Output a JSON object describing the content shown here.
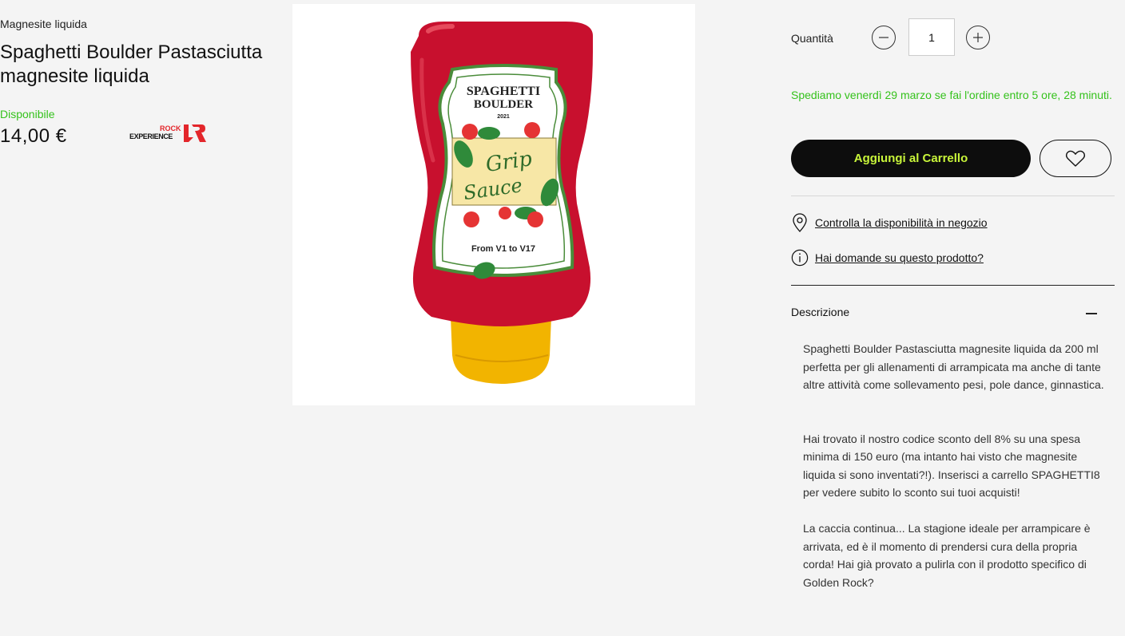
{
  "product": {
    "category": "Magnesite liquida",
    "title": "Spaghetti Boulder Pastasciutta magnesite liquida",
    "availability": "Disponibile",
    "price": "14,00 €",
    "brand": {
      "logo_text_top": "ROCK",
      "logo_text_bottom": "EXPERIENCE",
      "logo_icon": "rock-experience-logo"
    }
  },
  "image": {
    "label_line1": "SPAGHETTI",
    "label_line2": "BOULDER",
    "label_year": "2021",
    "label_script1": "Grip",
    "label_script2": "Sauce",
    "label_bottom": "From V1 to V17"
  },
  "purchase": {
    "quantity_label": "Quantità",
    "quantity_value": "1",
    "shipping_notice": "Spediamo venerdì 29 marzo se fai l'ordine entro 5 ore, 28 minuti.",
    "add_to_cart": "Aggiungi al Carrello"
  },
  "links": {
    "store_availability": "Controlla la disponibilità in negozio",
    "questions": "Hai domande su questo prodotto?"
  },
  "description": {
    "heading": "Descrizione",
    "paragraphs": [
      "Spaghetti Boulder Pastasciutta magnesite liquida da 200 ml perfetta per gli allenamenti di arrampicata ma anche di tante altre attività come sollevamento pesi, pole dance, ginnastica.",
      "Hai trovato il nostro codice sconto dell 8% su una spesa minima di 150 euro (ma intanto hai visto che magnesite liquida si sono inventati?!). Inserisci a carrello SPAGHETTI8 per vedere subito lo sconto sui tuoi acquisti!",
      "La caccia continua... La stagione ideale per arrampicare è arrivata, ed è il momento di prendersi cura della propria corda! Hai già provato a pulirla con il prodotto specifico di Golden Rock?"
    ]
  },
  "colors": {
    "background": "#f4f4f4",
    "accent_green": "#35c21c",
    "cart_button_bg": "#0d0d0d",
    "cart_button_text": "#c8f53a",
    "bottle_red": "#c8102e",
    "cap_yellow": "#f2b400",
    "logo_red": "#e3262b"
  },
  "icons": {
    "minus": "minus-icon",
    "plus": "plus-icon",
    "heart": "heart-icon",
    "location": "location-pin-icon",
    "info": "info-icon",
    "collapse": "collapse-minus-icon"
  }
}
